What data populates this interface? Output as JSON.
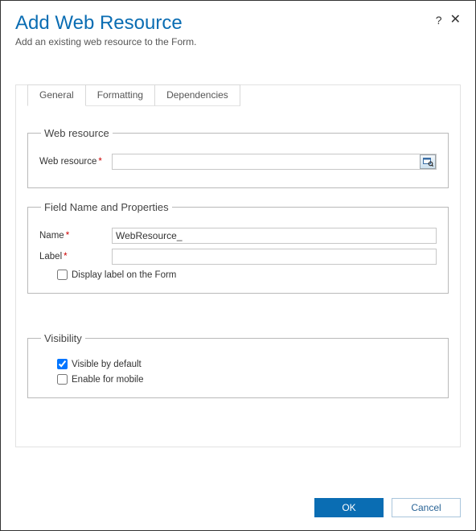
{
  "header": {
    "title": "Add Web Resource",
    "subtitle": "Add an existing web resource to the Form."
  },
  "tabs": [
    {
      "id": "general",
      "label": "General",
      "active": true
    },
    {
      "id": "formatting",
      "label": "Formatting",
      "active": false
    },
    {
      "id": "dependencies",
      "label": "Dependencies",
      "active": false
    }
  ],
  "groups": {
    "webResource": {
      "legend": "Web resource",
      "fieldLabel": "Web resource",
      "value": ""
    },
    "fieldNameProps": {
      "legend": "Field Name and Properties",
      "nameLabel": "Name",
      "nameValue": "WebResource_",
      "labelLabel": "Label",
      "labelValue": "",
      "displayLabelCheckbox": "Display label on the Form",
      "displayLabelChecked": false
    },
    "visibility": {
      "legend": "Visibility",
      "visibleLabel": "Visible by default",
      "visibleChecked": true,
      "mobileLabel": "Enable for mobile",
      "mobileChecked": false
    }
  },
  "buttons": {
    "ok": "OK",
    "cancel": "Cancel"
  }
}
